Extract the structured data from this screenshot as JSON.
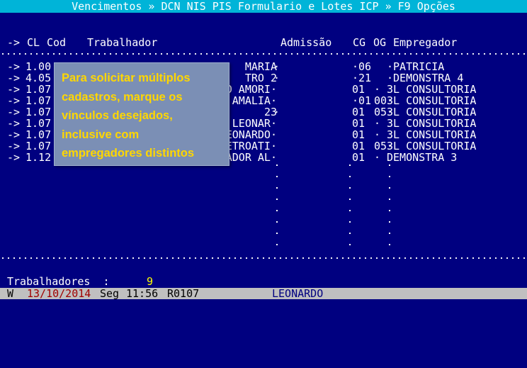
{
  "title": "Vencimentos » DCN NIS PIS Formulario e Lotes ICP » F9 Opções",
  "header": {
    "arrow": "->",
    "cl": "CL",
    "cod": "Cod",
    "trabalhador": "Trabalhador",
    "admissao": "Admissão",
    "cg": "CG",
    "og": "OG",
    "empregador": "Empregador"
  },
  "rows": [
    {
      "arrow": "->",
      "cod": "1.00",
      "trab": "MARIA",
      "adm": "·",
      "cg": "·06",
      "og": "",
      "emp": "·PATRICIA"
    },
    {
      "arrow": "->",
      "cod": "4.05",
      "trab": "TRO 2",
      "adm": "·",
      "cg": "·21",
      "og": "",
      "emp": "·DEMONSTRA 4"
    },
    {
      "arrow": "->",
      "cod": "1.07",
      "trab": "O AMORI·",
      "adm": "",
      "cg": "01",
      "og": "·",
      "emp": "3L CONSULTORIA"
    },
    {
      "arrow": "->",
      "cod": "1.07",
      "trab": "AMALIA·",
      "adm": "",
      "cg": "·01",
      "og": "00·",
      "emp": "3L CONSULTORIA"
    },
    {
      "arrow": "->",
      "cod": "1.07",
      "trab": "23",
      "adm": "·",
      "cg": "01",
      "og": "05·",
      "emp": "3L CONSULTORIA"
    },
    {
      "arrow": "->",
      "cod": "1.07",
      "trab": "LEONAR·",
      "adm": "",
      "cg": "01",
      "og": "·",
      "emp": "3L CONSULTORIA"
    },
    {
      "arrow": "->",
      "cod": "1.07",
      "trab": "EONARDO·",
      "adm": "",
      "cg": "01",
      "og": "·",
      "emp": "3L CONSULTORIA"
    },
    {
      "arrow": "->",
      "cod": "1.07",
      "trab": "ETROATI·",
      "adm": "",
      "cg": "01",
      "og": "05·",
      "emp": "3L CONSULTORIA"
    },
    {
      "arrow": "->",
      "cod": "1.12",
      "trab": "ADOR AL·",
      "adm": "",
      "cg": "01",
      "og": "·",
      "emp": "DEMONSTRA 3"
    }
  ],
  "tooltip": {
    "text": "Para solicitar múltiplos cadastros, marque os vínculos desejados, inclusive com empregadores distintos"
  },
  "footer": {
    "label": "Trabalhadores  :",
    "count": "9"
  },
  "status": {
    "mode": "W",
    "date": "13/10/2014",
    "weekday": "Seg",
    "time": "11:56",
    "code": "R0107",
    "user": "LEONARDO"
  },
  "colors": {
    "background": "#000080",
    "title_bar": "#00b4d8",
    "tooltip_bg": "#7b8fb5",
    "tooltip_text": "#ffd700",
    "count": "#ffff00",
    "status_bar": "#c0c0c0",
    "status_date": "#a00000",
    "status_user": "#000080"
  }
}
